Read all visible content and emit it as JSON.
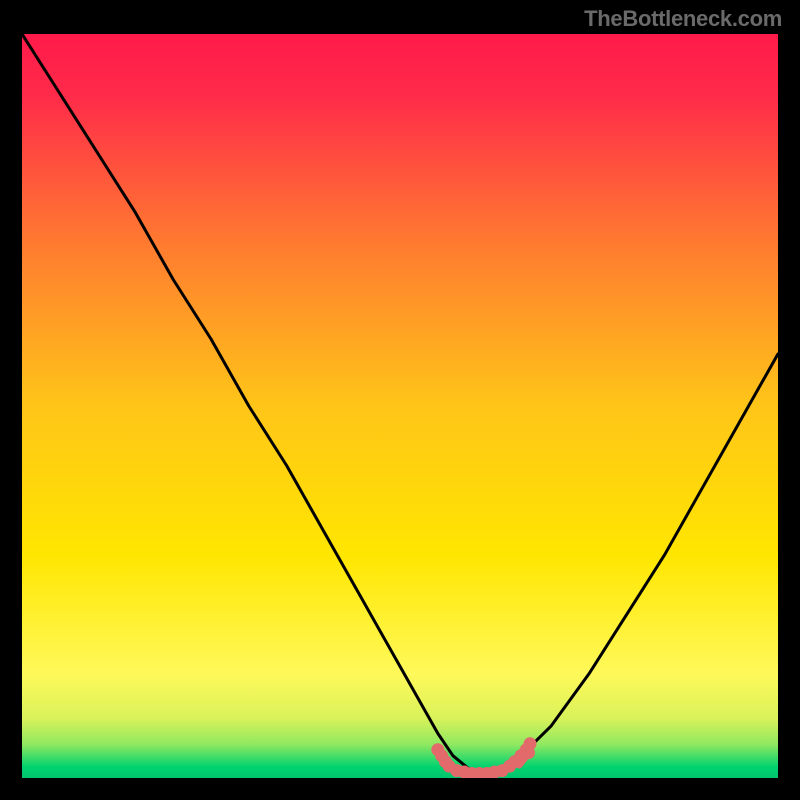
{
  "watermark": "TheBottleneck.com",
  "chart_data": {
    "type": "line",
    "title": "",
    "xlabel": "",
    "ylabel": "",
    "xlim": [
      0,
      100
    ],
    "ylim": [
      0,
      100
    ],
    "grid": false,
    "legend": false,
    "gradient": {
      "top": "#ff1a4a",
      "mid": "#ffd500",
      "bottom": "#00e36f"
    },
    "series": [
      {
        "name": "bottleneck-curve",
        "color": "#000000",
        "x": [
          0,
          5,
          10,
          15,
          20,
          25,
          30,
          35,
          40,
          45,
          50,
          55,
          57,
          60,
          63,
          66,
          70,
          75,
          80,
          85,
          90,
          95,
          100
        ],
        "y": [
          100,
          92,
          84,
          76,
          67,
          59,
          50,
          42,
          33,
          24,
          15,
          6,
          3,
          0.5,
          0.5,
          3,
          7,
          14,
          22,
          30,
          39,
          48,
          57
        ]
      }
    ],
    "annotations": [
      {
        "name": "optimal-marker",
        "type": "dotted-overlay",
        "color": "#e26a6a",
        "x_range": [
          55,
          67
        ],
        "y": 1.5
      }
    ]
  }
}
